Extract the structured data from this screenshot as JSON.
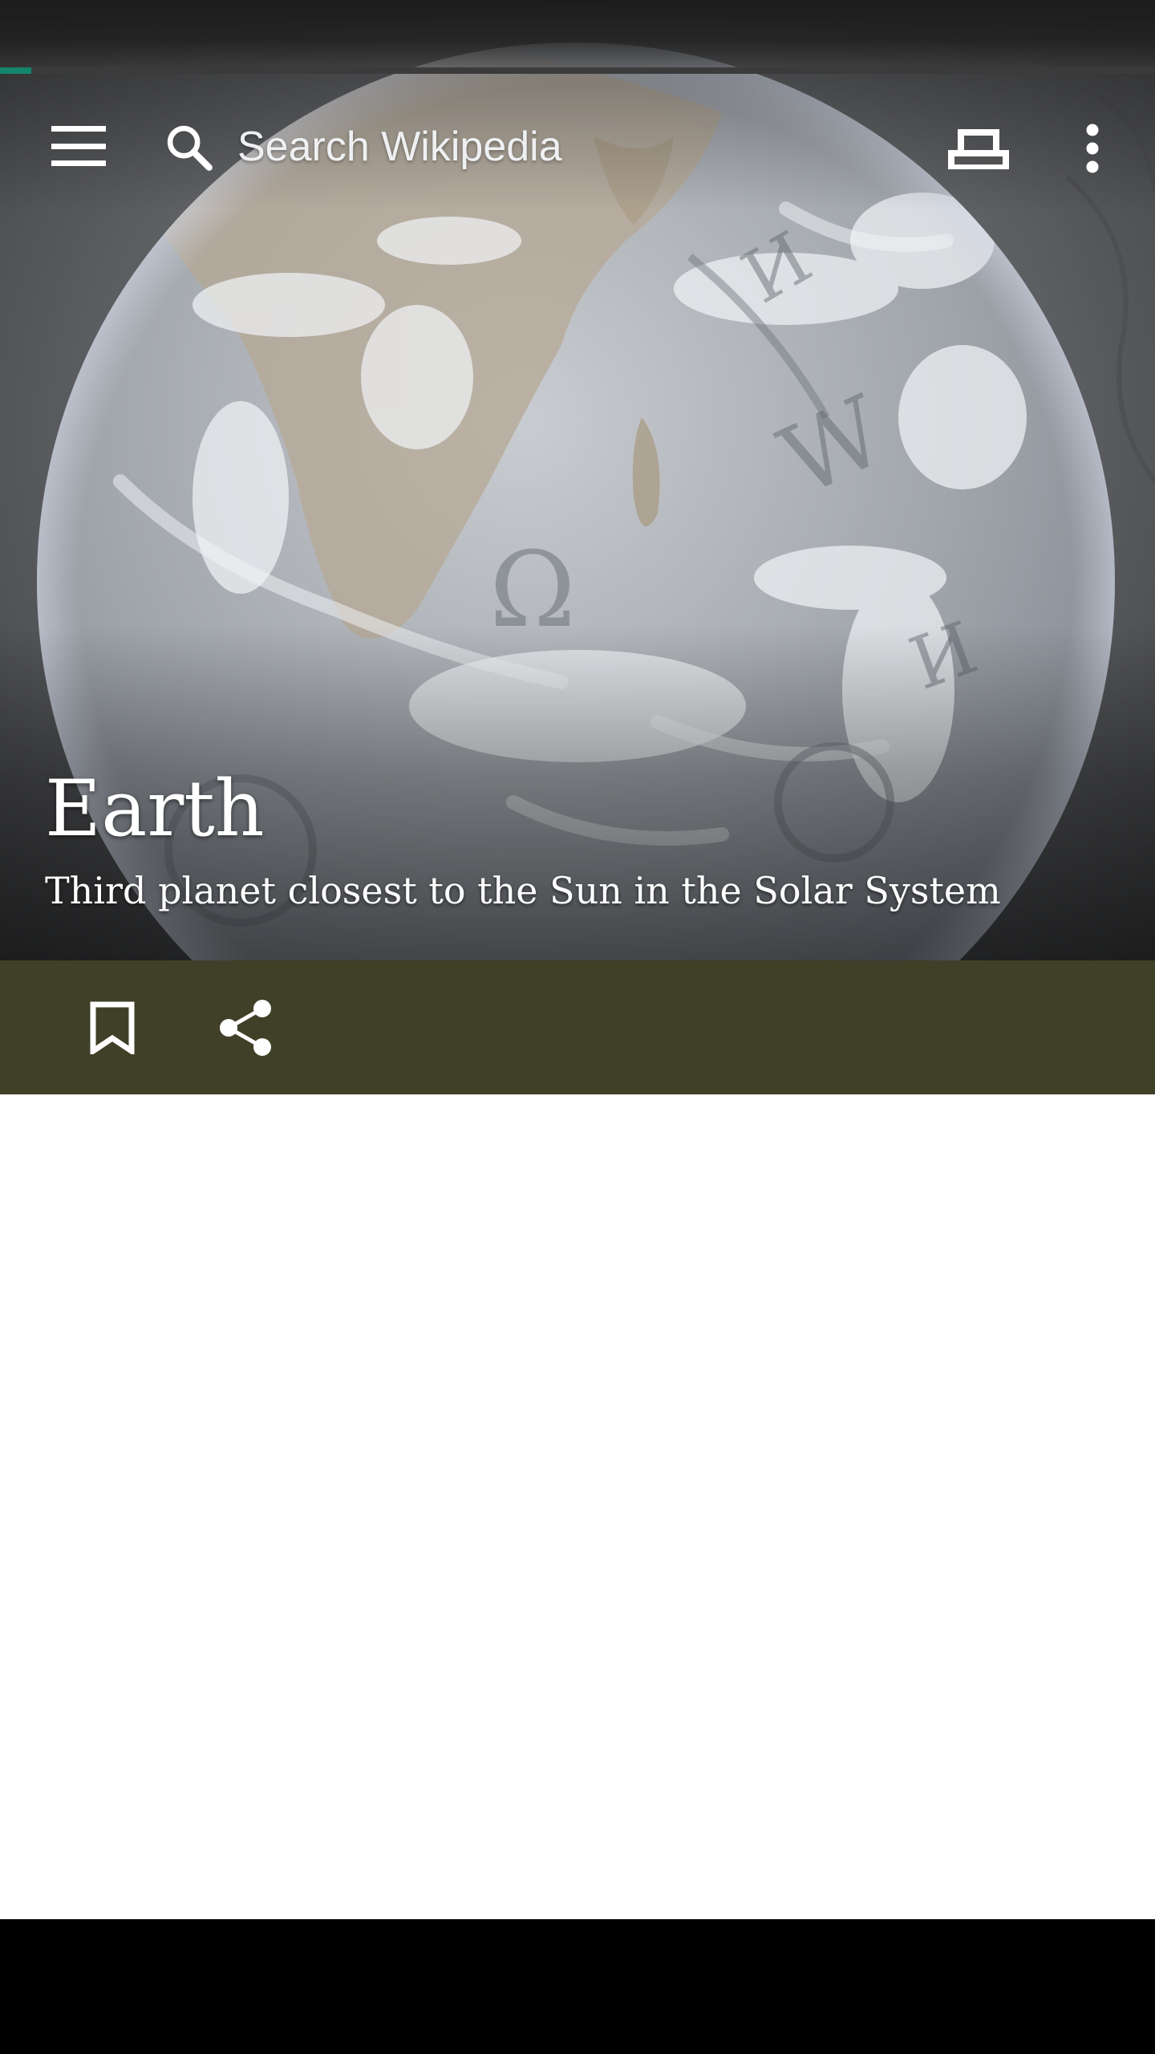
{
  "load_progress": 0.027,
  "toolbar": {
    "menu_icon": "hamburger-menu-icon",
    "search_icon": "search-icon",
    "search_placeholder": "Search Wikipedia",
    "tabs_icon": "tabs-icon",
    "overflow_icon": "more-vert-icon"
  },
  "article": {
    "title": "Earth",
    "description": "Third planet closest to the Sun in the Solar System"
  },
  "actions": {
    "save_icon": "bookmark-icon",
    "share_icon": "share-icon"
  },
  "colors": {
    "progress": "#14866d",
    "action_bar": "#403f28",
    "nav_bar": "#000000"
  }
}
